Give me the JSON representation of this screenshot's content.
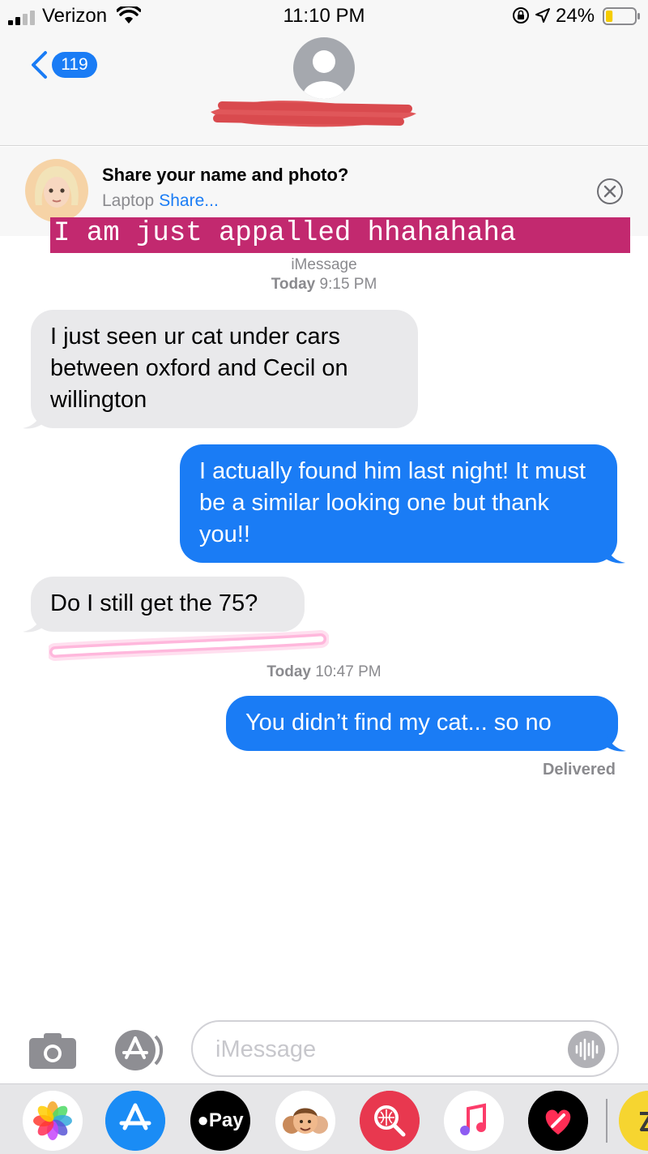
{
  "status_bar": {
    "carrier": "Verizon",
    "time": "11:10 PM",
    "battery_percent": "24%",
    "battery_level": 0.24,
    "icons": [
      "signal-icon",
      "wifi-icon",
      "rotation-lock-icon",
      "location-icon",
      "battery-icon"
    ]
  },
  "header": {
    "back_badge": "119",
    "accent": "#1a7cf5"
  },
  "share_banner": {
    "title": "Share your name and photo?",
    "device": "Laptop",
    "action": "Share..."
  },
  "overlay": {
    "caption": "I am just appalled hhahahaha",
    "color": "#c2296f"
  },
  "conversation": {
    "service": "iMessage",
    "timestamps": [
      {
        "day": "Today",
        "time": "9:15 PM"
      },
      {
        "day": "Today",
        "time": "10:47 PM"
      }
    ],
    "messages": [
      {
        "direction": "incoming",
        "text": "I just seen ur cat under cars between oxford and Cecil on willington"
      },
      {
        "direction": "outgoing",
        "text": "I actually found him last night! It must be a similar looking one but thank you!!"
      },
      {
        "direction": "incoming",
        "text": "Do I still get the 75?"
      },
      {
        "direction": "outgoing",
        "text": "You didn’t find my cat... so no"
      }
    ],
    "delivery_status": "Delivered"
  },
  "input": {
    "placeholder": "iMessage"
  },
  "app_drawer": {
    "items": [
      "photos-app-icon",
      "app-store-icon",
      "apple-pay-icon",
      "memoji-icon",
      "web-image-search-icon",
      "music-app-icon",
      "digital-touch-icon",
      "sticker-app-icon"
    ],
    "pay_label": "Pay"
  },
  "colors": {
    "outgoing_bubble": "#1a7cf5",
    "incoming_bubble": "#e9e9eb",
    "timestamp_text": "#8a8a8e"
  }
}
